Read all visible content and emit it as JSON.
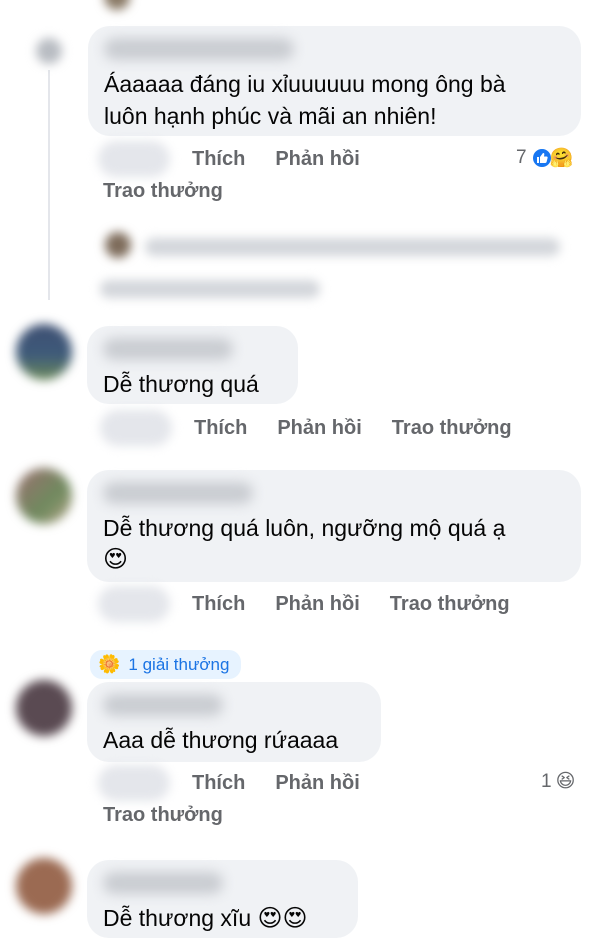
{
  "comments": [
    {
      "text_line1": "Áaaaaa đáng iu xỉuuuuuu mong ông bà",
      "text_line2": "luôn hạnh phúc và mãi an nhiên!",
      "like_label": "Thích",
      "reply_label": "Phản hồi",
      "reward_label": "Trao thưởng",
      "reaction_count": "7",
      "reaction_icons": [
        "like-icon",
        "hug-emoji-icon"
      ]
    },
    {
      "text": "Dễ thương quá",
      "like_label": "Thích",
      "reply_label": "Phản hồi",
      "reward_label": "Trao thưởng"
    },
    {
      "text_line1": "Dễ thương quá luôn,  ngưỡng mộ quá ạ",
      "text_emoji": "😍",
      "like_label": "Thích",
      "reply_label": "Phản hồi",
      "reward_label": "Trao thưởng"
    },
    {
      "award_label": "1 giải thưởng",
      "text": "Aaa dễ thương rứaaaa",
      "like_label": "Thích",
      "reply_label": "Phản hồi",
      "reward_label": "Trao thưởng",
      "reaction_count": "1",
      "reaction_icons": [
        "laughing-emoji-icon"
      ]
    },
    {
      "text": "Dễ thương xĩu",
      "text_emoji": "😍😍"
    }
  ],
  "colors": {
    "bubble": "#f0f2f5",
    "action_text": "#65676b",
    "like_blue": "#1877f2",
    "award_bg": "#e7f3ff"
  }
}
